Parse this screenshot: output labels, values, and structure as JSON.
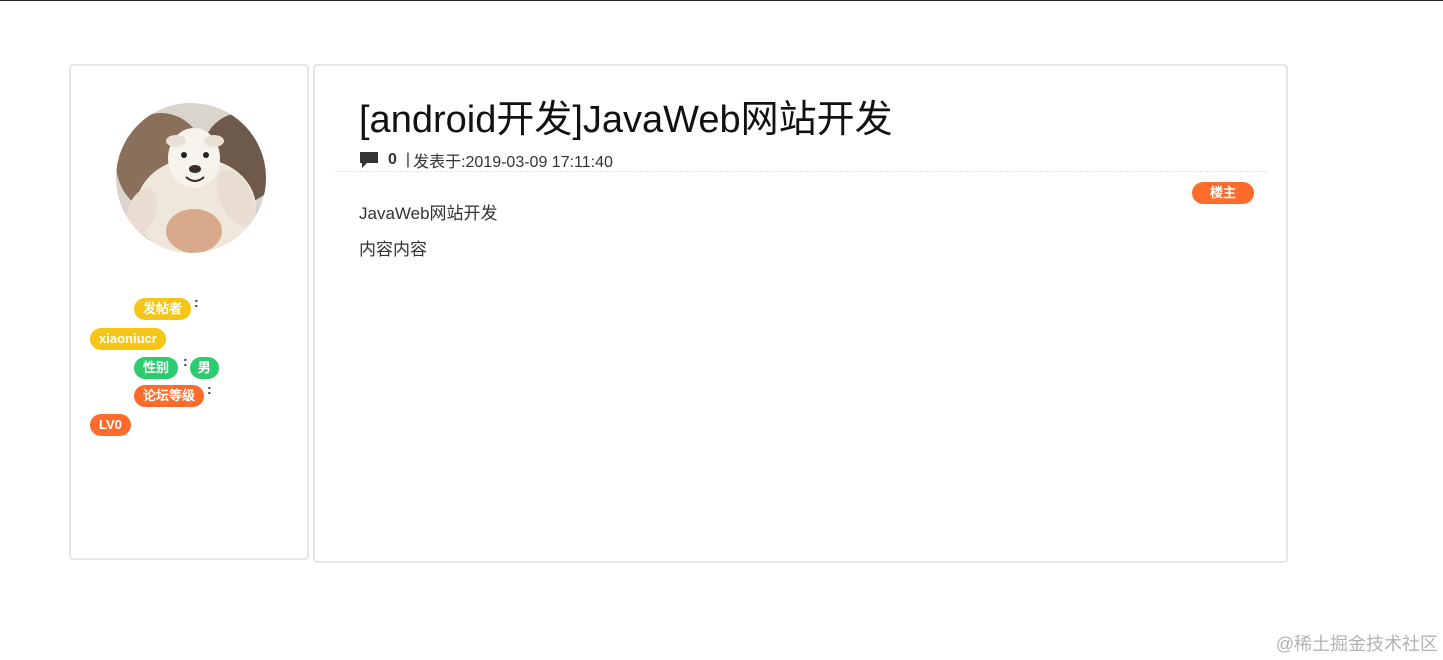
{
  "author": {
    "avatar_alt": "sheep-avatar",
    "poster_label": "发帖者",
    "poster_name": "xiaoniucr",
    "gender_label": "性别",
    "gender_value": "男",
    "level_label": "论坛等级",
    "level_value": "LV0",
    "colon": ":"
  },
  "post": {
    "title": "[android开发]JavaWeb网站开发",
    "comment_count": "0",
    "separator": "|",
    "posted_at": "发表于:2019-03-09 17:11:40",
    "owner_badge": "楼主",
    "paragraphs": [
      "JavaWeb网站开发",
      "内容内容"
    ]
  },
  "colors": {
    "badge_yellow": "#f5c518",
    "badge_green": "#2ecc71",
    "badge_orange": "#ff6b2b",
    "border": "#e6e6e6"
  },
  "icons": {
    "comment": "comment-icon"
  },
  "watermark": "@稀土掘金技术社区"
}
